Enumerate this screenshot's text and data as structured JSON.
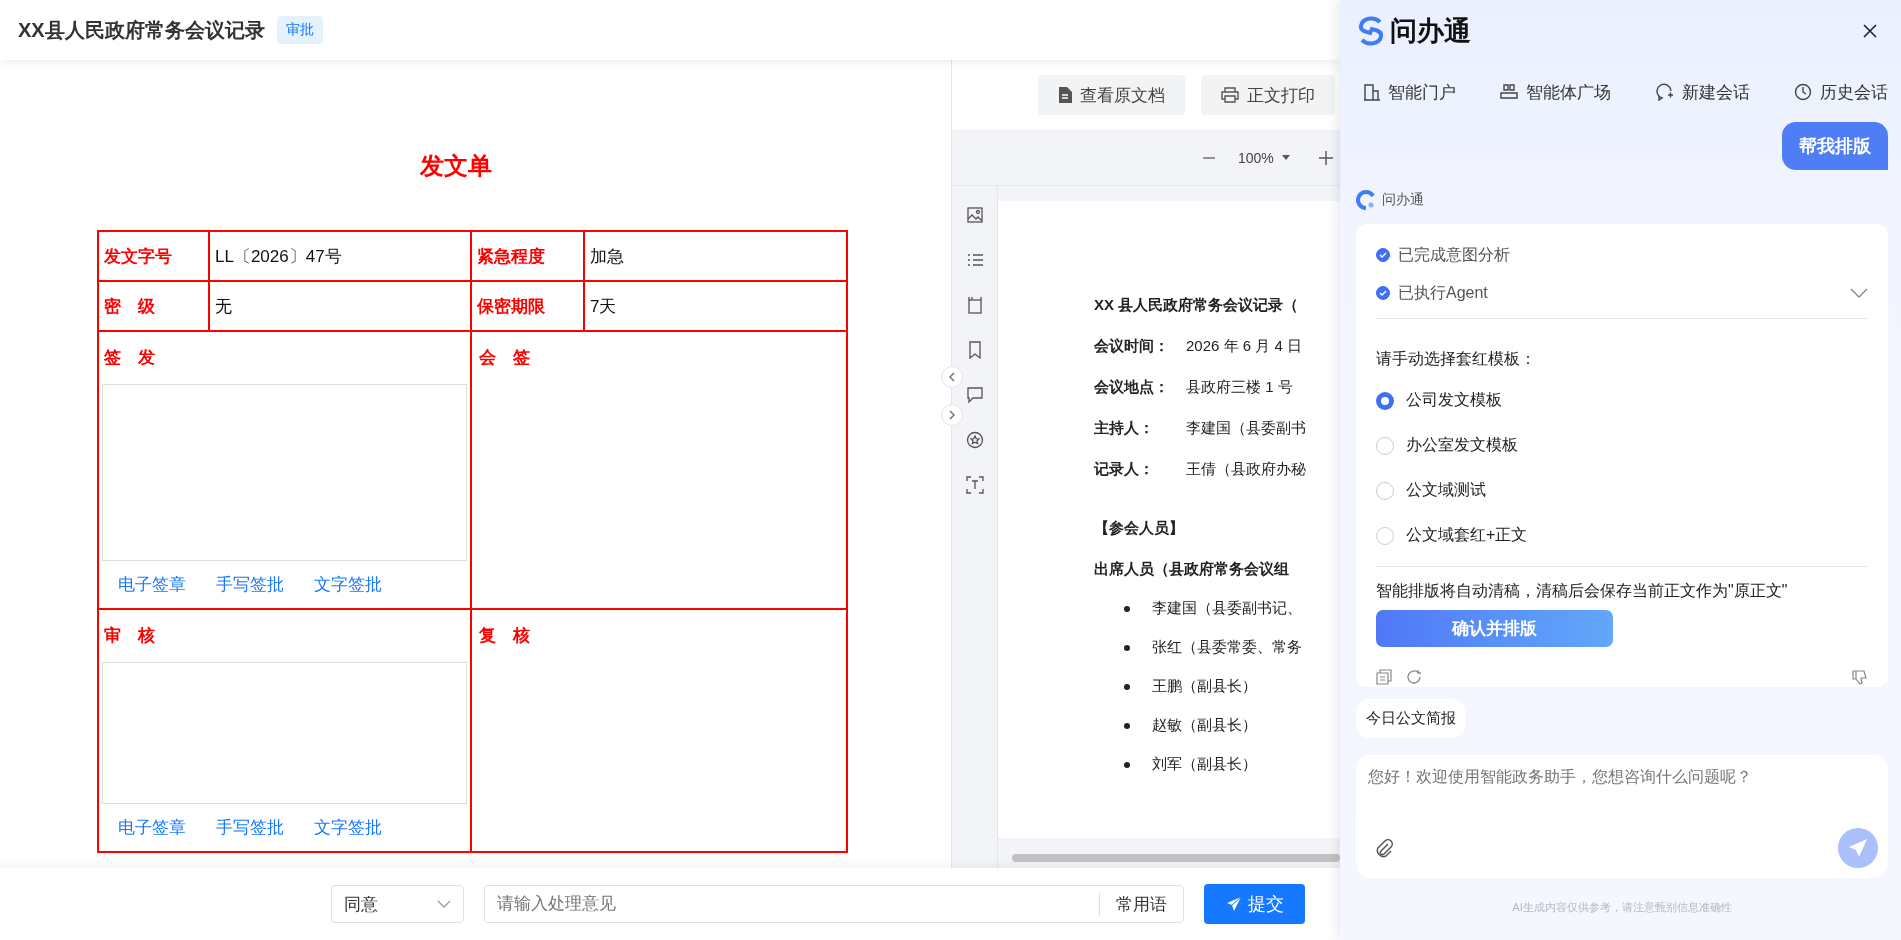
{
  "header": {
    "title": "XX县人民政府常务会议记录",
    "badge": "审批"
  },
  "form": {
    "title": "发文单",
    "rows": [
      {
        "label": "发文字号",
        "value": "LL〔2026〕47号",
        "label_2": "紧急程度",
        "value_2": "加急"
      },
      {
        "label": "密　级",
        "value": "无",
        "label_2": "保密期限",
        "value_2": "7天"
      }
    ],
    "sections": [
      {
        "label": "签　发",
        "label_2": "会　签",
        "actions": [
          "电子签章",
          "手写签批",
          "文字签批"
        ]
      },
      {
        "label": "审　核",
        "label_2": "复　核",
        "actions": [
          "电子签章",
          "手写签批",
          "文字签批"
        ]
      }
    ]
  },
  "doc_toolbar": {
    "buttons": [
      {
        "label": "查看原文档",
        "kind": "document"
      },
      {
        "label": "正文打印",
        "kind": "print"
      }
    ],
    "zoom": "100%"
  },
  "document": {
    "title": "XX 县人民政府常务会议记录（",
    "fields": [
      {
        "label": "会议时间：",
        "value": "2026 年 6 月 4 日"
      },
      {
        "label": "会议地点：",
        "value": "县政府三楼 1 号"
      },
      {
        "label": "主持人：",
        "value": "李建国（县委副书"
      },
      {
        "label": "记录人：",
        "value": "王倩（县政府办秘"
      }
    ],
    "section": "【参会人员】",
    "subheading": "出席人员（县政府常务会议组",
    "attendees": [
      "李建国（县委副书记、",
      "张红（县委常委、常务",
      "王鹏（副县长）",
      "赵敏（副县长）",
      "刘军（副县长）"
    ]
  },
  "bottom_bar": {
    "opinion": "同意",
    "placeholder": "请输入处理意见",
    "phrases": "常用语",
    "submit": "提交"
  },
  "assistant": {
    "brand": "问办通",
    "nav": [
      {
        "label": "智能门户",
        "kind": "portal"
      },
      {
        "label": "智能体广场",
        "kind": "agents"
      },
      {
        "label": "新建会话",
        "kind": "new"
      },
      {
        "label": "历史会话",
        "kind": "history"
      }
    ],
    "user_message": "帮我排版",
    "bot_name": "问办通",
    "steps": [
      {
        "label": "已完成意图分析",
        "checked": true
      },
      {
        "label": "已执行Agent",
        "checked": true
      }
    ],
    "prompt": "请手动选择套红模板：",
    "options": [
      {
        "label": "公司发文模板",
        "selected": true
      },
      {
        "label": "办公室发文模板",
        "selected": false
      },
      {
        "label": "公文域测试",
        "selected": false
      },
      {
        "label": "公文域套红+正文",
        "selected": false
      }
    ],
    "notice": "智能排版将自动清稿，清稿后会保存当前正文作为\"原正文\"",
    "confirm": "确认并排版",
    "chip": "今日公文简报",
    "input_placeholder": "您好！欢迎使用智能政务助手，您想咨询什么问题呢？",
    "disclaimer": "AI生成内容仅供参考，请注意甄别信息准确性"
  }
}
